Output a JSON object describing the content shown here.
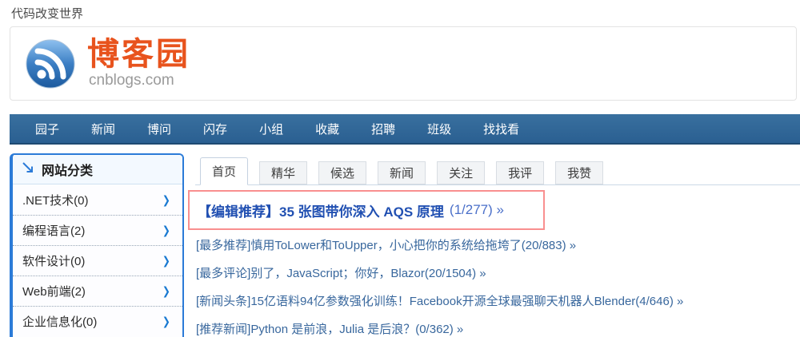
{
  "tagline": "代码改变世界",
  "logo": {
    "site_name": "博客园",
    "domain": "cnblogs.com"
  },
  "navbar": {
    "items": [
      "园子",
      "新闻",
      "博问",
      "闪存",
      "小组",
      "收藏",
      "招聘",
      "班级",
      "找找看"
    ]
  },
  "sidebar": {
    "title": "网站分类",
    "chevron": "❯",
    "items": [
      {
        "label": ".NET技术(0)"
      },
      {
        "label": "编程语言(2)"
      },
      {
        "label": "软件设计(0)"
      },
      {
        "label": "Web前端(2)"
      },
      {
        "label": "企业信息化(0)"
      }
    ]
  },
  "tabs": {
    "items": [
      {
        "label": "首页"
      },
      {
        "label": "精华"
      },
      {
        "label": "候选"
      },
      {
        "label": "新闻"
      },
      {
        "label": "关注"
      },
      {
        "label": "我评"
      },
      {
        "label": "我赞"
      }
    ],
    "active": "首页"
  },
  "headline": {
    "title": "【编辑推荐】35 张图带你深入 AQS 原理",
    "count": "(1/277) »"
  },
  "posts": {
    "items": [
      {
        "text": "[最多推荐]慎用ToLower和ToUpper，小心把你的系统给拖垮了(20/883) »"
      },
      {
        "text": "[最多评论]别了，JavaScript；你好，Blazor(20/1504) »"
      },
      {
        "text": "[新闻头条]15亿语料94亿参数强化训练！Facebook开源全球最强聊天机器人Blender(4/646) »"
      },
      {
        "text": "[推荐新闻]Python 是前浪，Julia 是后浪？(0/362) »"
      }
    ]
  },
  "colors": {
    "nav_blue": "#2d6597",
    "logo_orange": "#e8531d",
    "sidebar_border_blue": "#2b7bd8",
    "link_blue": "#38679d",
    "headline_blue": "#2150b2",
    "headline_count_blue": "#4a6fc9",
    "annotation_red": "#f98f8f"
  }
}
